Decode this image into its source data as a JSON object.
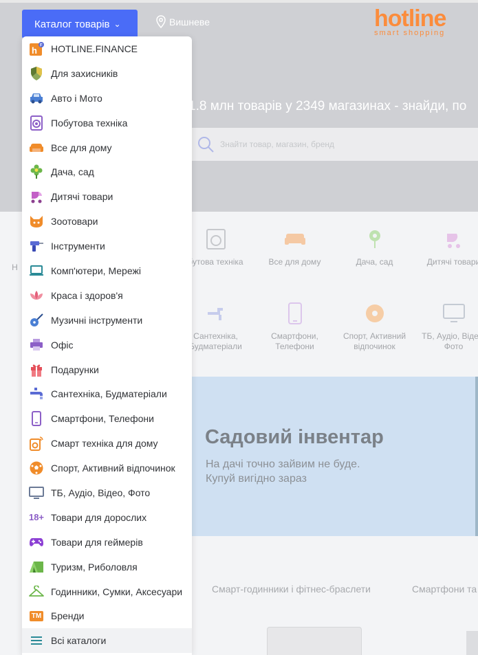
{
  "header": {
    "catalog_button": "Каталог товарів",
    "location": "Вишневе",
    "logo_main": "hotline",
    "logo_sub": "smart shopping",
    "tagline": "1.8 млн товарів у 2349 магазинах - знайди, по",
    "search_placeholder": "Знайти товар, магазин, бренд"
  },
  "categories_row1": [
    "Н",
    "бутова техніка",
    "Все для дому",
    "Дача, сад",
    "Дитячі товари"
  ],
  "categories_row2": [
    "Сантехніка, Будматеріали",
    "Смартфони, Телефони",
    "Спорт, Активний відпочинок",
    "ТБ, Аудіо, Відео, Фото"
  ],
  "categories_row2_lines": [
    [
      "Сантехніка,",
      "Будматеріали"
    ],
    [
      "Смартфони,",
      "Телефони"
    ],
    [
      "Спорт, Активний",
      "відпочинок"
    ],
    [
      "ТБ, Аудіо, Відео,",
      "Фото"
    ]
  ],
  "banner": {
    "title": "Садовий інвентар",
    "line1": "На дачі точно зайвим не буде.",
    "line2": "Купуй вигідно зараз"
  },
  "bottom_tabs": [
    "Смарт-годинники і фітнес-браслети",
    "Смартфони та"
  ],
  "menu": {
    "items": [
      {
        "label": "HOTLINE.FINANCE",
        "icon": "hotline-finance-icon",
        "color": "#f08c2a"
      },
      {
        "label": "Для захисників",
        "icon": "shield-icon",
        "color": "#6d8f3a"
      },
      {
        "label": "Авто і Мото",
        "icon": "car-icon",
        "color": "#4a7fd4"
      },
      {
        "label": "Побутова техніка",
        "icon": "washing-machine-icon",
        "color": "#8c5fc7"
      },
      {
        "label": "Все для дому",
        "icon": "sofa-icon",
        "color": "#f08c2a"
      },
      {
        "label": "Дача, сад",
        "icon": "flower-icon",
        "color": "#6cb64a"
      },
      {
        "label": "Дитячі товари",
        "icon": "stroller-icon",
        "color": "#c35fc7"
      },
      {
        "label": "Зоотовари",
        "icon": "cat-icon",
        "color": "#f08c2a"
      },
      {
        "label": "Інструменти",
        "icon": "drill-icon",
        "color": "#5a6bd4"
      },
      {
        "label": "Комп'ютери, Мережі",
        "icon": "laptop-icon",
        "color": "#2a8a96"
      },
      {
        "label": "Краса і здоров'я",
        "icon": "lotus-icon",
        "color": "#e4607a"
      },
      {
        "label": "Музичні інструменти",
        "icon": "guitar-icon",
        "color": "#4a7fd4"
      },
      {
        "label": "Офіс",
        "icon": "printer-icon",
        "color": "#8c5fc7"
      },
      {
        "label": "Подарунки",
        "icon": "gift-icon",
        "color": "#e4505a"
      },
      {
        "label": "Сантехніка, Будматеріали",
        "icon": "faucet-icon",
        "color": "#5a6bd4"
      },
      {
        "label": "Смартфони, Телефони",
        "icon": "smartphone-icon",
        "color": "#8c5fc7"
      },
      {
        "label": "Смарт техніка для дому",
        "icon": "smart-home-icon",
        "color": "#f08c2a"
      },
      {
        "label": "Спорт, Активний відпочинок",
        "icon": "ball-icon",
        "color": "#f08c2a"
      },
      {
        "label": "ТБ, Аудіо, Відео, Фото",
        "icon": "tv-icon",
        "color": "#6b7a96"
      },
      {
        "label": "Товари для дорослих",
        "icon": "adult-18-icon",
        "color": "#8c5fc7"
      },
      {
        "label": "Товари для геймерів",
        "icon": "gamepad-icon",
        "color": "#8c3fd4"
      },
      {
        "label": "Туризм, Риболовля",
        "icon": "tent-icon",
        "color": "#6cb64a"
      },
      {
        "label": "Годинники, Сумки, Аксесуари",
        "icon": "hanger-icon",
        "color": "#6cb64a"
      },
      {
        "label": "Бренди",
        "icon": "trademark-icon",
        "color": "#f08c2a"
      },
      {
        "label": "Всі каталоги",
        "icon": "list-icon",
        "color": "#2a8a96"
      }
    ],
    "adult_badge": "18+",
    "brand_badge": "TM"
  }
}
